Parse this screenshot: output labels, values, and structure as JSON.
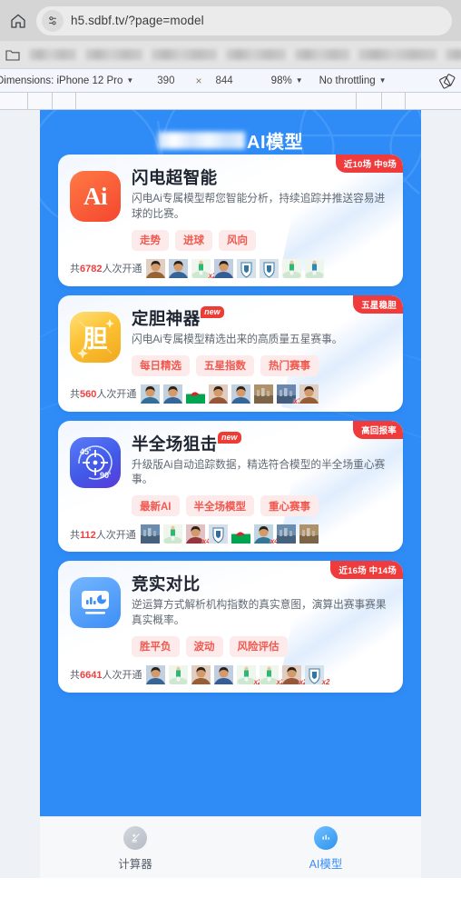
{
  "browser": {
    "url": "h5.sdbf.tv/?page=model",
    "home_icon": "home-icon",
    "tune_icon": "tune-icon",
    "bookmark_folder_icon": "folder-icon"
  },
  "devtools": {
    "dimensions_label": "Dimensions: iPhone 12 Pro",
    "width": "390",
    "times": "×",
    "height": "844",
    "zoom": "98%",
    "throttling": "No throttling",
    "rotate_icon": "rotate-device-icon"
  },
  "page": {
    "title_prefix_blurred": "",
    "title": "AI模型"
  },
  "cards": [
    {
      "icon_name": "ai-lightning-icon",
      "icon_text": "Ai",
      "badge": "近10场 中9场",
      "new_badge": "",
      "title": "闪电超智能",
      "desc": "闪电Ai专属模型帮您智能分析，持续追踪并推送容易进球的比赛。",
      "tags": [
        "走势",
        "进球",
        "风向"
      ],
      "foot_prefix": "共",
      "foot_count": "6782",
      "foot_suffix": "人次开通",
      "avatars": [
        {
          "type": "person",
          "hue": 28,
          "multi": ""
        },
        {
          "type": "person",
          "hue": 210,
          "multi": ""
        },
        {
          "type": "jersey",
          "hue": 150,
          "multi": "x2"
        },
        {
          "type": "person",
          "hue": 215,
          "multi": ""
        },
        {
          "type": "crest",
          "hue": 205,
          "multi": ""
        },
        {
          "type": "crest",
          "hue": 205,
          "multi": ""
        },
        {
          "type": "jersey",
          "hue": 150,
          "multi": ""
        },
        {
          "type": "jersey",
          "hue": 200,
          "multi": ""
        }
      ]
    },
    {
      "icon_name": "dan-star-icon",
      "icon_text": "胆",
      "badge": "五星稳胆",
      "new_badge": "new",
      "title": "定胆神器",
      "desc": "闪电Ai专属模型精选出来的高质量五星赛事。",
      "tags": [
        "每日精选",
        "五星指数",
        "热门赛事"
      ],
      "foot_prefix": "共",
      "foot_count": "560",
      "foot_suffix": "人次开通",
      "avatars": [
        {
          "type": "person",
          "hue": 205,
          "multi": ""
        },
        {
          "type": "person",
          "hue": 0,
          "multi": ""
        },
        {
          "type": "flag-wales",
          "hue": 0,
          "multi": ""
        },
        {
          "type": "person",
          "hue": 20,
          "multi": ""
        },
        {
          "type": "person",
          "hue": 210,
          "multi": ""
        },
        {
          "type": "stadium",
          "hue": 35,
          "multi": ""
        },
        {
          "type": "stadium",
          "hue": 215,
          "multi": "x3"
        },
        {
          "type": "person",
          "hue": 25,
          "multi": ""
        }
      ]
    },
    {
      "icon_name": "half-full-sniper-icon",
      "icon_text": "",
      "badge": "高回报率",
      "new_badge": "new",
      "title": "半全场狙击",
      "desc": "升级版Ai自动追踪数据，精选符合模型的半全场重心赛事。",
      "tags": [
        "最新AI",
        "半全场模型",
        "重心赛事"
      ],
      "foot_prefix": "共",
      "foot_count": "112",
      "foot_suffix": "人次开通",
      "avatars": [
        {
          "type": "stadium",
          "hue": 210,
          "multi": ""
        },
        {
          "type": "jersey",
          "hue": 150,
          "multi": ""
        },
        {
          "type": "person",
          "hue": 355,
          "multi": "x4"
        },
        {
          "type": "crest",
          "hue": 210,
          "multi": ""
        },
        {
          "type": "flag-wales",
          "hue": 0,
          "multi": ""
        },
        {
          "type": "person",
          "hue": 200,
          "multi": "x4"
        },
        {
          "type": "stadium",
          "hue": 0,
          "multi": ""
        },
        {
          "type": "stadium",
          "hue": 35,
          "multi": ""
        }
      ]
    },
    {
      "icon_name": "comparison-chart-icon",
      "icon_text": "",
      "badge": "近16场 中14场",
      "new_badge": "",
      "title": "竞实对比",
      "desc": "逆运算方式解析机构指数的真实意图，演算出赛事赛果真实概率。",
      "tags": [
        "胜平负",
        "波动",
        "风险评估"
      ],
      "foot_prefix": "共",
      "foot_count": "6641",
      "foot_suffix": "人次开通",
      "avatars": [
        {
          "type": "person",
          "hue": 210,
          "multi": ""
        },
        {
          "type": "jersey",
          "hue": 150,
          "multi": ""
        },
        {
          "type": "person",
          "hue": 25,
          "multi": ""
        },
        {
          "type": "person",
          "hue": 215,
          "multi": ""
        },
        {
          "type": "jersey",
          "hue": 150,
          "multi": "x2"
        },
        {
          "type": "jersey",
          "hue": 150,
          "multi": "x2"
        },
        {
          "type": "person",
          "hue": 20,
          "multi": "x2"
        },
        {
          "type": "crest",
          "hue": 205,
          "multi": "x2"
        }
      ]
    }
  ],
  "tabbar": {
    "tabs": [
      {
        "icon_name": "calculator-icon",
        "label": "计算器",
        "active": false
      },
      {
        "icon_name": "ai-model-icon",
        "label": "AI模型",
        "active": true
      }
    ]
  },
  "colors": {
    "brand_blue": "#2f8cf7",
    "badge_red": "#ef3b3b",
    "tag_bg": "#fdeaea",
    "tag_text": "#f0594f",
    "active_tab": "#3b8ef5"
  }
}
